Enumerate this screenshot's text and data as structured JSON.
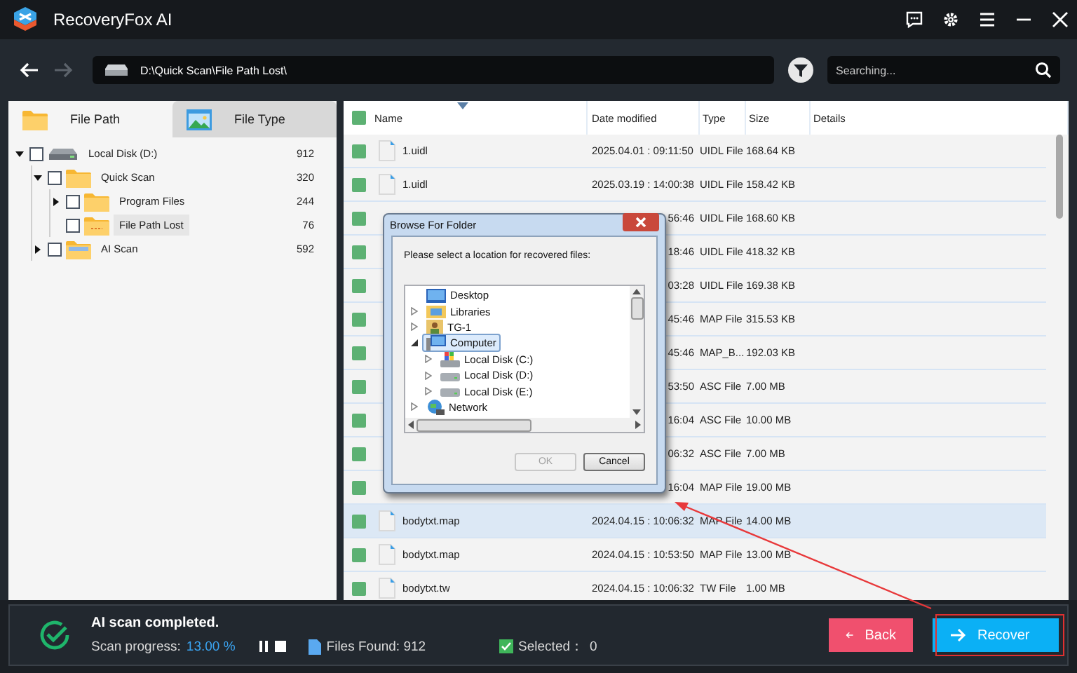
{
  "window": {
    "title": "RecoveryFox AI"
  },
  "toolbar": {
    "path": "D:\\Quick Scan\\File Path Lost\\",
    "search": {
      "placeholder": "Searching..."
    }
  },
  "left_tabs": [
    {
      "label": "File Path",
      "selected": true
    },
    {
      "label": "File Type",
      "selected": false
    }
  ],
  "tree": [
    {
      "label": "Local Disk (D:)",
      "count": "912",
      "kind": "disk",
      "expanded": true,
      "checked": false,
      "selected": false,
      "children": [
        {
          "label": "Quick Scan",
          "count": "320",
          "kind": "folder",
          "expanded": true,
          "checked": false,
          "selected": false,
          "children": [
            {
              "label": "Program Files",
              "count": "244",
              "kind": "folder",
              "expanded": false,
              "checked": false,
              "selected": false
            },
            {
              "label": "File Path Lost",
              "count": "76",
              "kind": "lost",
              "checked": false,
              "selected": true
            }
          ]
        },
        {
          "label": "AI Scan",
          "count": "592",
          "kind": "ai",
          "expanded": false,
          "checked": false,
          "selected": false
        }
      ]
    }
  ],
  "table": {
    "all_checked": true,
    "columns": [
      {
        "label": "Name",
        "sorted": true
      },
      {
        "label": "Date modified",
        "sorted": false
      },
      {
        "label": "Type",
        "sorted": false
      },
      {
        "label": "Size",
        "sorted": false
      },
      {
        "label": "Details",
        "sorted": false
      }
    ],
    "rows": [
      {
        "kind": "file",
        "name": "1.uidl",
        "date": "2025.04.01 : 09:11:50",
        "type": "UIDL File",
        "size": "168.64 KB",
        "checked": true,
        "selected": false
      },
      {
        "kind": "file",
        "name": "1.uidl",
        "date": "2025.03.19 : 14:00:38",
        "type": "UIDL File",
        "size": "158.42 KB",
        "checked": true,
        "selected": false
      },
      {
        "kind": "covered",
        "date": "56:46",
        "type": "UIDL File",
        "size": "168.60 KB",
        "checked": true,
        "selected": false
      },
      {
        "kind": "covered",
        "date": "18:46",
        "type": "UIDL File",
        "size": "418.32 KB",
        "checked": true,
        "selected": false
      },
      {
        "kind": "covered",
        "date": "03:28",
        "type": "UIDL File",
        "size": "169.38 KB",
        "checked": true,
        "selected": false
      },
      {
        "kind": "covered",
        "date": "45:46",
        "type": "MAP File",
        "size": "315.53 KB",
        "checked": true,
        "selected": false
      },
      {
        "kind": "covered",
        "date": "45:46",
        "type": "MAP_B...",
        "size": "192.03 KB",
        "checked": true,
        "selected": false
      },
      {
        "kind": "covered",
        "date": "53:50",
        "type": "ASC File",
        "size": "7.00 MB",
        "checked": true,
        "selected": false
      },
      {
        "kind": "covered",
        "date": "16:04",
        "type": "ASC File",
        "size": "10.00 MB",
        "checked": true,
        "selected": false
      },
      {
        "kind": "covered",
        "date": "06:32",
        "type": "ASC File",
        "size": "7.00 MB",
        "checked": true,
        "selected": false
      },
      {
        "kind": "covered",
        "date": "16:04",
        "type": "MAP File",
        "size": "19.00 MB",
        "checked": true,
        "selected": false
      },
      {
        "kind": "file",
        "name": "bodytxt.map",
        "date": "2024.04.15 : 10:06:32",
        "type": "MAP File",
        "size": "14.00 MB",
        "checked": true,
        "selected": true
      },
      {
        "kind": "file",
        "name": "bodytxt.map",
        "date": "2024.04.15 : 10:53:50",
        "type": "MAP File",
        "size": "13.00 MB",
        "checked": true,
        "selected": false
      },
      {
        "kind": "file",
        "name": "bodytxt.tw",
        "date": "2024.04.15 : 10:06:32",
        "type": "TW File",
        "size": "1.00 MB",
        "checked": true,
        "selected": false
      }
    ]
  },
  "dialog": {
    "title": "Browse For Folder",
    "prompt": "Please select a location for recovered files:",
    "tree": [
      {
        "label": "Desktop",
        "kind": "desktop",
        "selected": false
      },
      {
        "label": "Libraries",
        "kind": "libraries",
        "expanded": false,
        "selected": false
      },
      {
        "label": "TG-1",
        "kind": "user",
        "expanded": false,
        "selected": false
      },
      {
        "label": "Computer",
        "kind": "computer",
        "expanded": true,
        "selected": true,
        "children": [
          {
            "label": "Local Disk (C:)",
            "kind": "system",
            "expanded": false,
            "selected": false
          },
          {
            "label": "Local Disk (D:)",
            "kind": "disk",
            "expanded": false,
            "selected": false
          },
          {
            "label": "Local Disk (E:)",
            "kind": "disk",
            "expanded": false,
            "selected": false
          }
        ]
      },
      {
        "label": "Network",
        "kind": "network",
        "expanded": false,
        "selected": false
      }
    ],
    "buttons": [
      {
        "label": "OK",
        "disabled": true
      },
      {
        "label": "Cancel",
        "disabled": false
      }
    ]
  },
  "status": {
    "title": "AI scan completed.",
    "progress_label": "Scan progress:",
    "progress_value": "13.00 %",
    "files_found": "Files Found: 912",
    "selected_label": "Selected：",
    "selected_count": "0",
    "selected_checked": true
  },
  "actions": [
    {
      "label": "Back",
      "kind": "back",
      "highlighted": false
    },
    {
      "label": "Recover",
      "kind": "recover",
      "highlighted": true
    }
  ]
}
